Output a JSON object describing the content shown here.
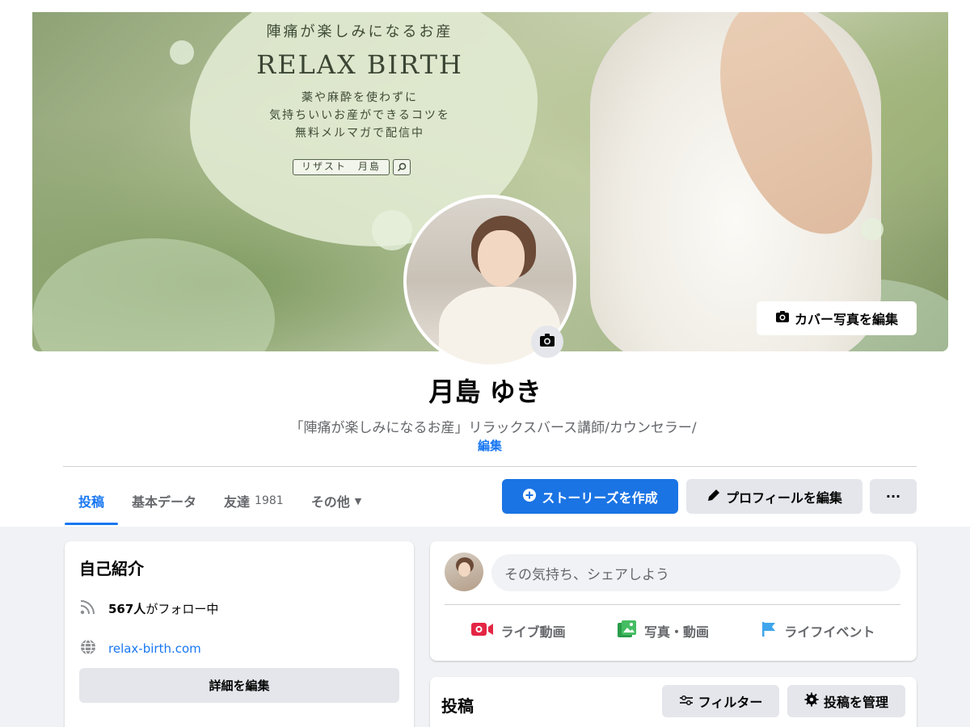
{
  "cover": {
    "ad_line1": "陣痛が楽しみになるお産",
    "ad_title": "RELAX BIRTH",
    "ad_body_1": "薬や麻酔を使わずに",
    "ad_body_2": "気持ちいいお産ができるコツを",
    "ad_body_3": "無料メルマガで配信中",
    "ad_search": "リザスト　月島",
    "edit_cover_label": "カバー写真を編集"
  },
  "profile": {
    "name": "月島 ゆき",
    "tagline": "「陣痛が楽しみになるお産」リラックスバース講師/カウンセラー/",
    "edit_link": "編集"
  },
  "tabs": [
    {
      "label": "投稿",
      "active": true
    },
    {
      "label": "基本データ"
    },
    {
      "label": "友達",
      "count": "1981"
    },
    {
      "label": "その他",
      "caret": "▼"
    }
  ],
  "actions": {
    "story": "ストーリーズを作成",
    "edit_profile": "プロフィールを編集",
    "more": "···"
  },
  "intro": {
    "title": "自己紹介",
    "follow_count": "567人",
    "follow_suffix": "がフォロー中",
    "website": "relax-birth.com",
    "edit_details": "詳細を編集"
  },
  "composer": {
    "placeholder": "その気持ち、シェアしよう",
    "live": "ライブ動画",
    "photo": "写真・動画",
    "life_event": "ライフイベント"
  },
  "posts": {
    "title": "投稿",
    "filter": "フィルター",
    "manage": "投稿を管理"
  },
  "colors": {
    "accent": "#1877f2",
    "button_blue": "#1b74e4",
    "secondary_bg": "#e4e6eb",
    "page_bg": "#f0f2f5",
    "live_red": "#e42645",
    "photo_green": "#45bd62",
    "event_blue": "#3ea6ec"
  }
}
